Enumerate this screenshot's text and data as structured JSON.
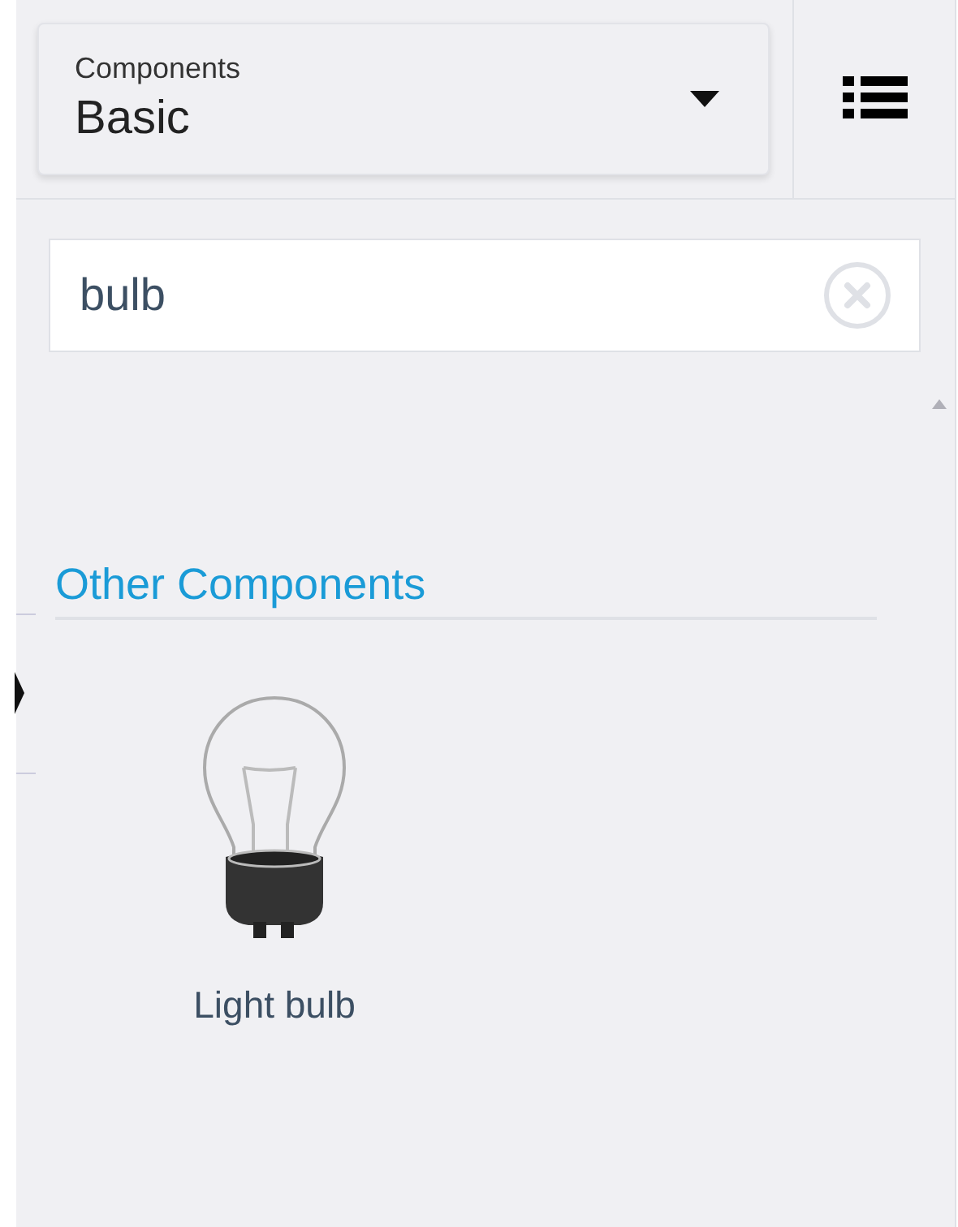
{
  "category_select": {
    "label": "Components",
    "value": "Basic"
  },
  "search": {
    "value": "bulb"
  },
  "sections": [
    {
      "title": "Other Components",
      "items": [
        {
          "label": "Light bulb"
        }
      ]
    }
  ]
}
